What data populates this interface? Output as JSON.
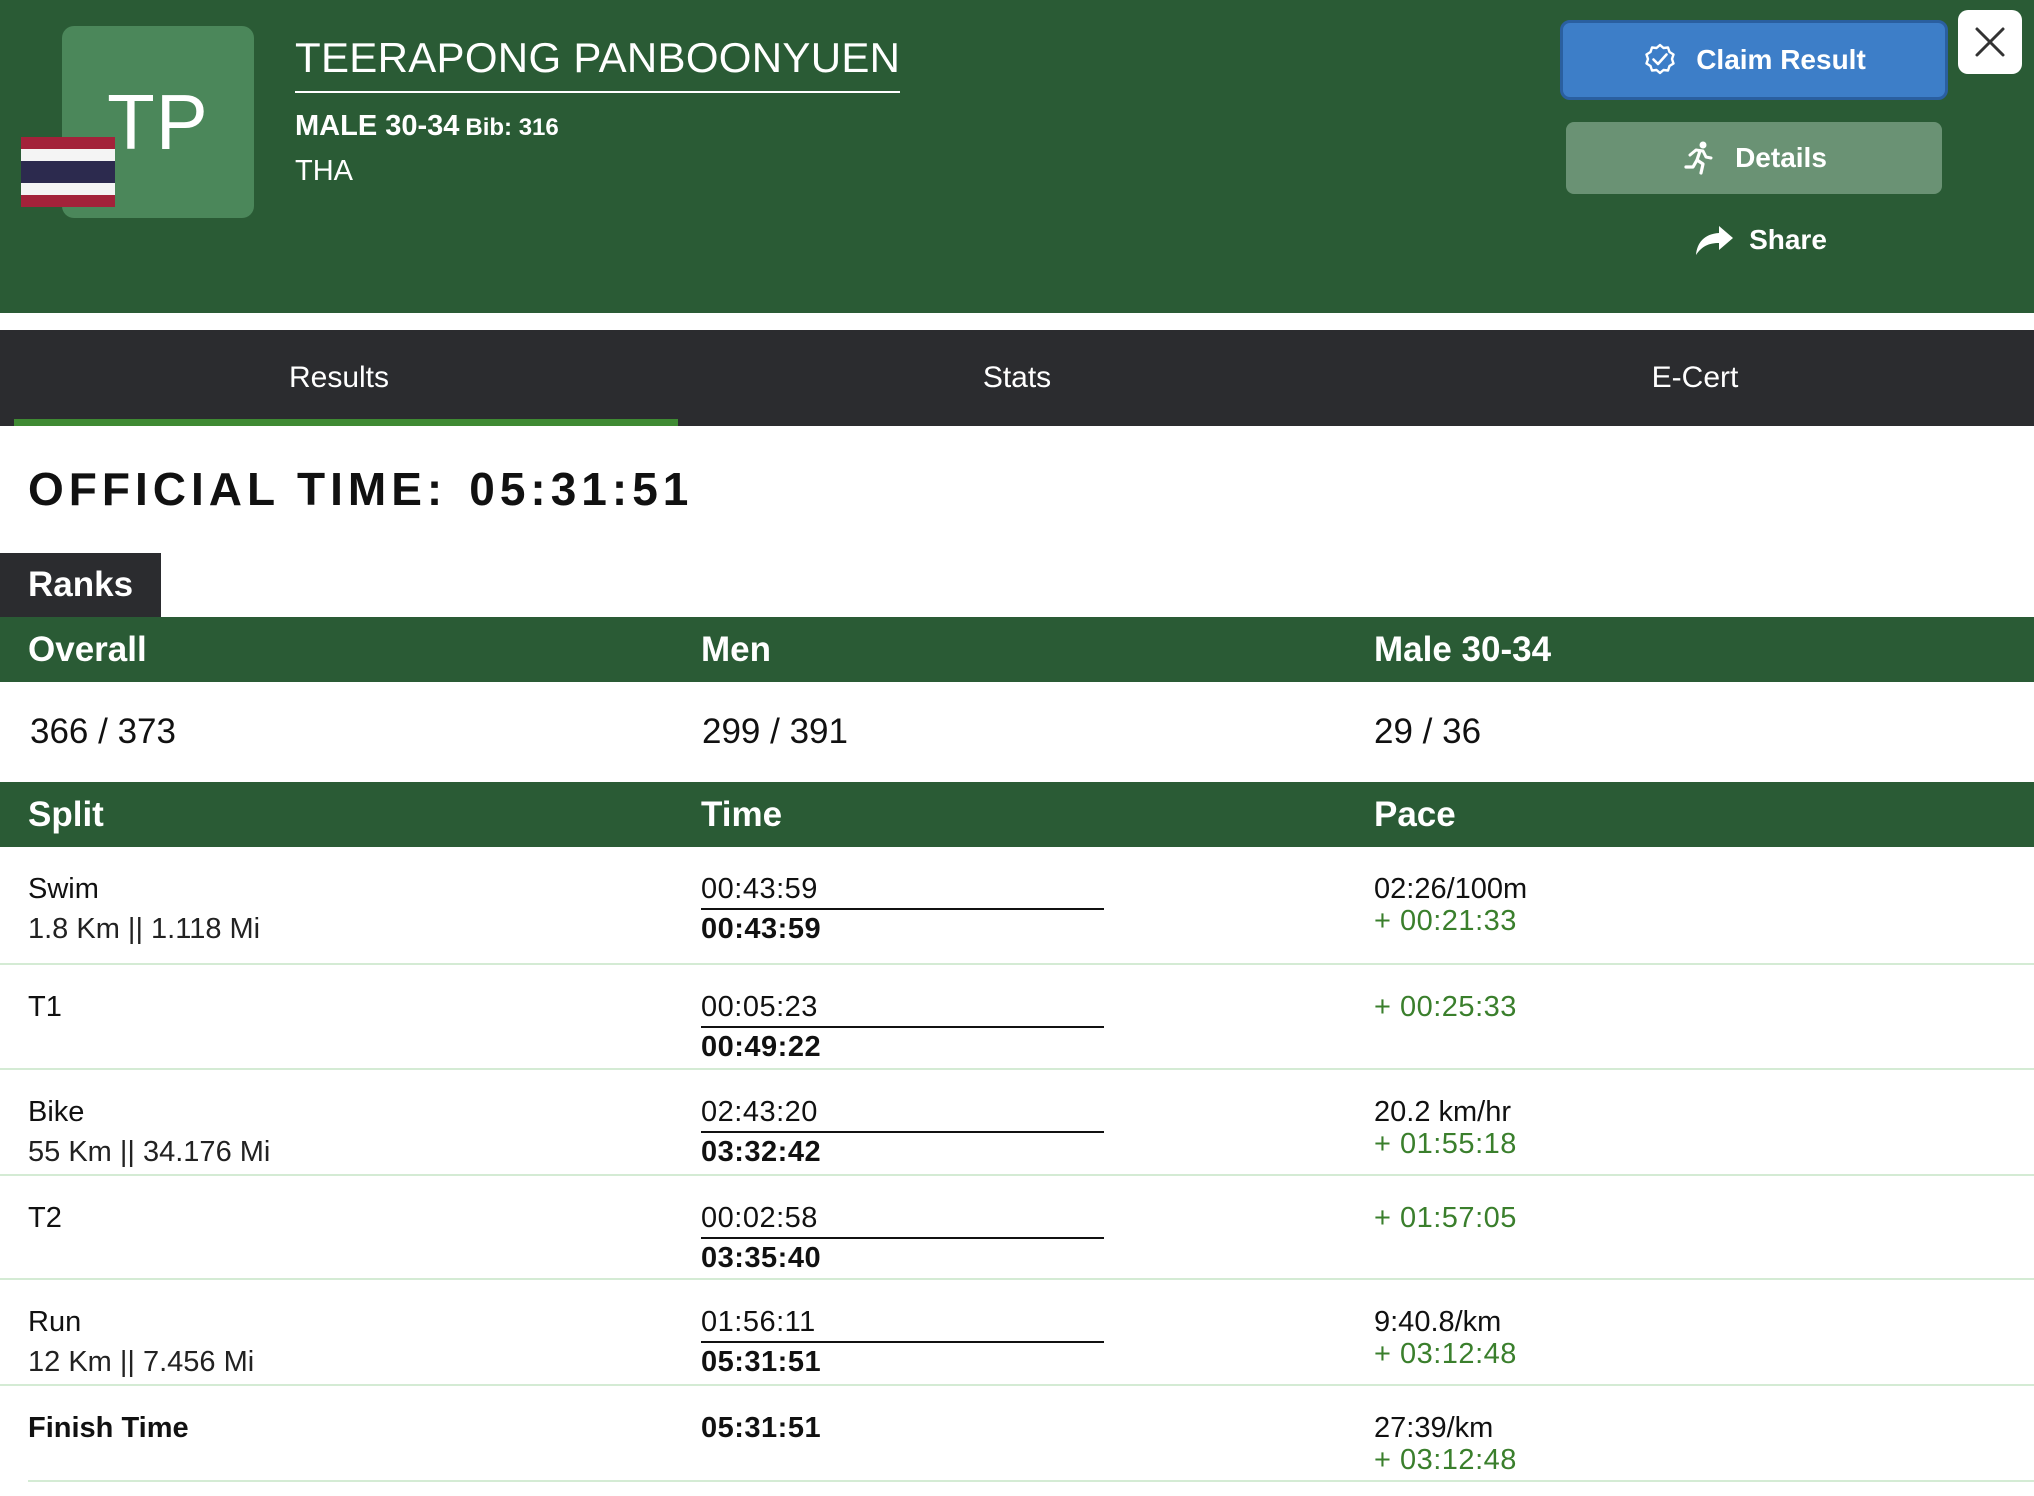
{
  "athlete": {
    "initials": "TP",
    "name": "TEERAPONG PANBOONYUEN",
    "category": "MALE 30-34",
    "bib_label": "Bib: 316",
    "country": "THA",
    "flag_icon": "thailand-flag-icon"
  },
  "actions": {
    "claim_label": "Claim Result",
    "details_label": "Details",
    "share_label": "Share"
  },
  "colors": {
    "header_green": "#2a5b35",
    "claim_blue": "#3d7ec8",
    "details_green": "#6a9274",
    "tab_bar": "#2b2c2f",
    "tab_indicator": "#3f8a33",
    "delta_green": "#3a7f2c"
  },
  "tabs": [
    {
      "label": "Results",
      "active": true
    },
    {
      "label": "Stats",
      "active": false
    },
    {
      "label": "E-Cert",
      "active": false
    }
  ],
  "official_time": {
    "label": "OFFICIAL TIME:",
    "value": "05:31:51"
  },
  "ranks": {
    "title": "Ranks",
    "headers": [
      "Overall",
      "Men",
      "Male 30-34"
    ],
    "values": [
      "366 / 373",
      "299 / 391",
      "29 / 36"
    ]
  },
  "splits": {
    "headers": [
      "Split",
      "Time",
      "Pace"
    ],
    "rows": [
      {
        "name": "Swim",
        "distance": "1.8 Km || 1.118 Mi",
        "split_time": "00:43:59",
        "cumulative": "00:43:59",
        "pace": "02:26/100m",
        "delta": "+ 00:21:33"
      },
      {
        "name": "T1",
        "distance": "",
        "split_time": "00:05:23",
        "cumulative": "00:49:22",
        "pace": "",
        "delta": "+ 00:25:33"
      },
      {
        "name": "Bike",
        "distance": "55 Km || 34.176 Mi",
        "split_time": "02:43:20",
        "cumulative": "03:32:42",
        "pace": "20.2 km/hr",
        "delta": "+ 01:55:18"
      },
      {
        "name": "T2",
        "distance": "",
        "split_time": "00:02:58",
        "cumulative": "03:35:40",
        "pace": "",
        "delta": "+ 01:57:05"
      },
      {
        "name": "Run",
        "distance": "12 Km || 7.456 Mi",
        "split_time": "01:56:11",
        "cumulative": "05:31:51",
        "pace": "9:40.8/km",
        "delta": "+ 03:12:48"
      }
    ],
    "finish": {
      "name": "Finish Time",
      "time": "05:31:51",
      "pace": "27:39/km",
      "delta": "+ 03:12:48"
    }
  }
}
